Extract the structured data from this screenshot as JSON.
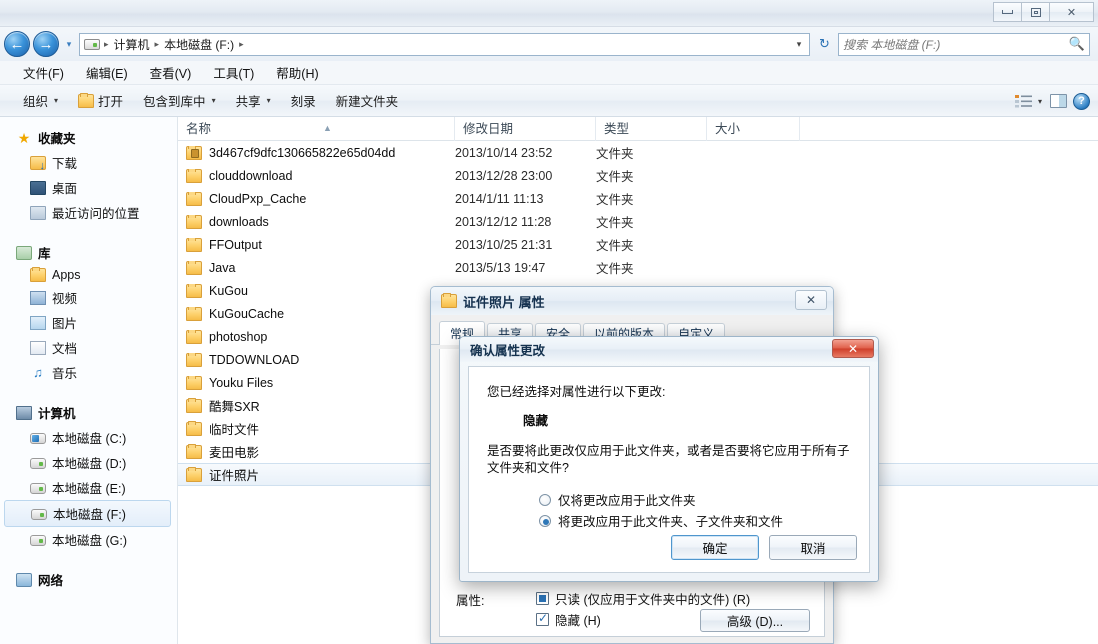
{
  "window": {
    "controls": {
      "minimize": "—",
      "restore": "❐",
      "close": "✕"
    }
  },
  "nav": {
    "back_icon": "←",
    "forward_icon": "→",
    "history_caret": "▾",
    "refresh_icon": "↻",
    "breadcrumbs": [
      "计算机",
      "本地磁盘 (F:)"
    ],
    "separator": "▸",
    "dropdown_caret": "▾"
  },
  "search": {
    "placeholder": "搜索 本地磁盘 (F:)",
    "icon": "search-icon"
  },
  "menubar": [
    {
      "label": "文件(F)"
    },
    {
      "label": "编辑(E)"
    },
    {
      "label": "查看(V)"
    },
    {
      "label": "工具(T)"
    },
    {
      "label": "帮助(H)"
    }
  ],
  "toolbar": {
    "organize": "组织",
    "open": "打开",
    "include_library": "包含到库中",
    "share": "共享",
    "burn": "刻录",
    "new_folder": "新建文件夹",
    "caret": "▾",
    "view_caret": "▾"
  },
  "sidebar": {
    "groups": [
      {
        "head": {
          "label": "收藏夹",
          "icon": "star-icon"
        },
        "items": [
          {
            "label": "下载",
            "icon": "download-folder-icon"
          },
          {
            "label": "桌面",
            "icon": "desktop-icon"
          },
          {
            "label": "最近访问的位置",
            "icon": "recent-places-icon"
          }
        ]
      },
      {
        "head": {
          "label": "库",
          "icon": "library-icon"
        },
        "items": [
          {
            "label": "Apps",
            "icon": "folder-icon"
          },
          {
            "label": "视频",
            "icon": "video-icon"
          },
          {
            "label": "图片",
            "icon": "picture-icon"
          },
          {
            "label": "文档",
            "icon": "document-icon"
          },
          {
            "label": "音乐",
            "icon": "music-icon"
          }
        ]
      },
      {
        "head": {
          "label": "计算机",
          "icon": "computer-icon"
        },
        "items": [
          {
            "label": "本地磁盘 (C:)",
            "icon": "hdd-system-icon",
            "selected": false
          },
          {
            "label": "本地磁盘 (D:)",
            "icon": "hdd-icon",
            "selected": false
          },
          {
            "label": "本地磁盘 (E:)",
            "icon": "hdd-icon",
            "selected": false
          },
          {
            "label": "本地磁盘 (F:)",
            "icon": "hdd-icon",
            "selected": true
          },
          {
            "label": "本地磁盘 (G:)",
            "icon": "hdd-icon",
            "selected": false
          }
        ]
      },
      {
        "head": {
          "label": "网络",
          "icon": "network-icon"
        },
        "items": []
      }
    ]
  },
  "filelist": {
    "columns": [
      "名称",
      "修改日期",
      "类型",
      "大小"
    ],
    "sort_indicator": "▲",
    "rows": [
      {
        "name": "3d467cf9dfc130665822e65d04dd",
        "date": "2013/10/14 23:52",
        "type": "文件夹",
        "size": "",
        "icon": "folder-locked-icon",
        "selected": false
      },
      {
        "name": "clouddownload",
        "date": "2013/12/28 23:00",
        "type": "文件夹",
        "size": "",
        "icon": "folder-icon",
        "selected": false
      },
      {
        "name": "CloudPxp_Cache",
        "date": "2014/1/11 11:13",
        "type": "文件夹",
        "size": "",
        "icon": "folder-icon",
        "selected": false
      },
      {
        "name": "downloads",
        "date": "2013/12/12 11:28",
        "type": "文件夹",
        "size": "",
        "icon": "folder-icon",
        "selected": false
      },
      {
        "name": "FFOutput",
        "date": "2013/10/25 21:31",
        "type": "文件夹",
        "size": "",
        "icon": "folder-icon",
        "selected": false
      },
      {
        "name": "Java",
        "date": "2013/5/13 19:47",
        "type": "文件夹",
        "size": "",
        "icon": "folder-icon",
        "selected": false
      },
      {
        "name": "KuGou",
        "date": "",
        "type": "",
        "size": "",
        "icon": "folder-icon",
        "selected": false
      },
      {
        "name": "KuGouCache",
        "date": "",
        "type": "",
        "size": "",
        "icon": "folder-icon",
        "selected": false
      },
      {
        "name": "photoshop",
        "date": "",
        "type": "",
        "size": "",
        "icon": "folder-icon",
        "selected": false
      },
      {
        "name": "TDDOWNLOAD",
        "date": "",
        "type": "",
        "size": "",
        "icon": "folder-icon",
        "selected": false
      },
      {
        "name": "Youku Files",
        "date": "",
        "type": "",
        "size": "",
        "icon": "folder-icon",
        "selected": false
      },
      {
        "name": "酷舞SXR",
        "date": "",
        "type": "",
        "size": "",
        "icon": "folder-icon",
        "selected": false
      },
      {
        "name": "临时文件",
        "date": "",
        "type": "",
        "size": "",
        "icon": "folder-icon",
        "selected": false
      },
      {
        "name": "麦田电影",
        "date": "",
        "type": "",
        "size": "",
        "icon": "folder-icon",
        "selected": false
      },
      {
        "name": "证件照片",
        "date": "",
        "type": "",
        "size": "",
        "icon": "folder-icon",
        "selected": true
      }
    ]
  },
  "properties_dialog": {
    "title": "证件照片 属性",
    "close": "✕",
    "tabs": [
      {
        "label": "常规",
        "active": true
      },
      {
        "label": "共享",
        "active": false
      },
      {
        "label": "安全",
        "active": false
      },
      {
        "label": "以前的版本",
        "active": false
      },
      {
        "label": "自定义",
        "active": false
      }
    ],
    "attributes_label": "属性:",
    "readonly_label": "只读 (仅应用于文件夹中的文件) (R)",
    "hidden_label": "隐藏 (H)",
    "advanced_button": "高级 (D)..."
  },
  "confirm_dialog": {
    "title": "确认属性更改",
    "close": "✕",
    "line1": "您已经选择对属性进行以下更改:",
    "attribute": "隐藏",
    "question": "是否要将此更改仅应用于此文件夹，或者是否要将它应用于所有子文件夹和文件?",
    "radio_folder_only": "仅将更改应用于此文件夹",
    "radio_folder_sub_files": "将更改应用于此文件夹、子文件夹和文件",
    "ok": "确定",
    "cancel": "取消"
  },
  "colors": {
    "accent": "#2f78b8",
    "folder": "#fdd06a",
    "selection": "#e3eefa",
    "close_red": "#cf3f2b"
  }
}
